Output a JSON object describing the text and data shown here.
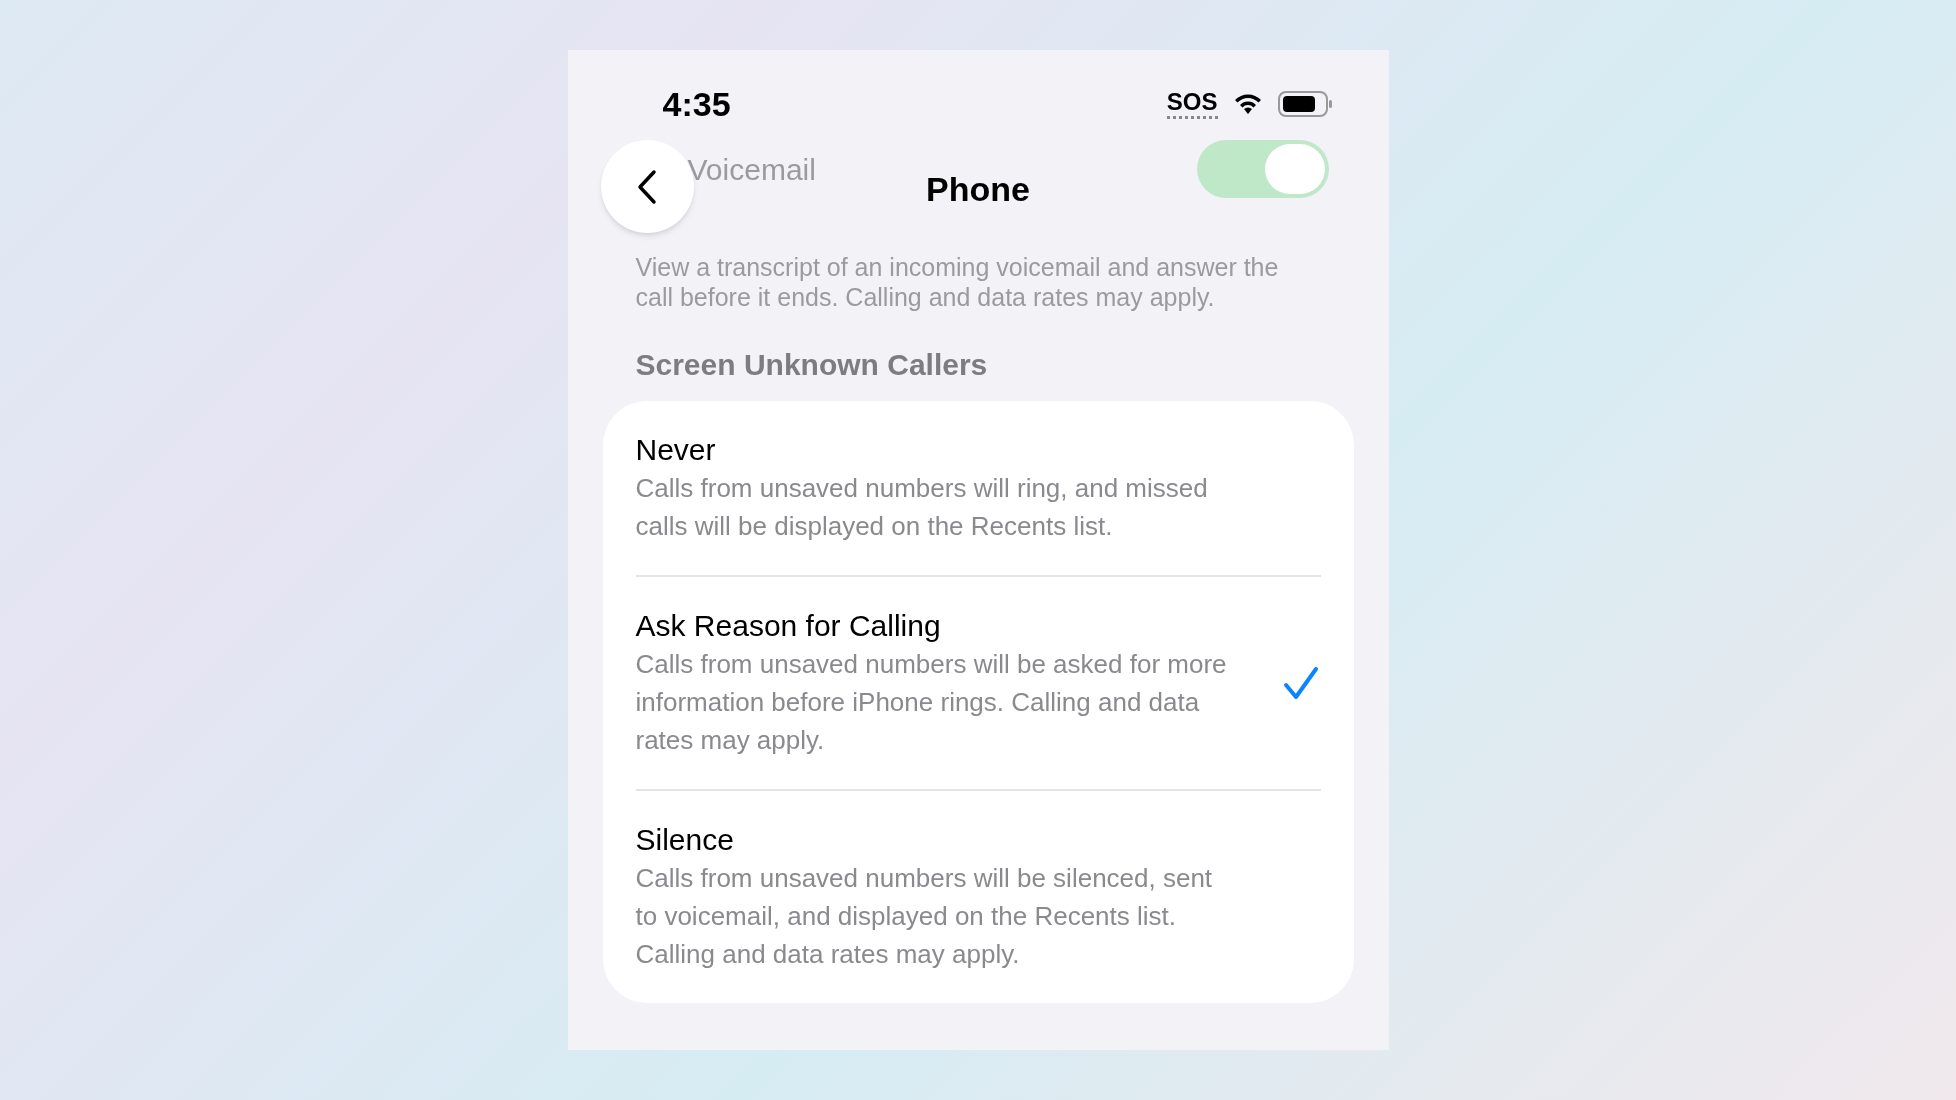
{
  "status_bar": {
    "time": "4:35",
    "sos": "SOS"
  },
  "background_row": {
    "label": "Voicemail",
    "on": true
  },
  "nav": {
    "title": "Phone"
  },
  "description": "View a transcript of an incoming voicemail and answer the call before it ends. Calling and data rates may apply.",
  "section": {
    "title": "Screen Unknown Callers",
    "options": [
      {
        "title": "Never",
        "description": "Calls from unsaved numbers will ring, and missed calls will be displayed on the Recents list.",
        "selected": false
      },
      {
        "title": "Ask Reason for Calling",
        "description": "Calls from unsaved numbers will be asked for more information before iPhone rings. Calling and data rates may apply.",
        "selected": true
      },
      {
        "title": "Silence",
        "description": "Calls from unsaved numbers will be silenced, sent to voicemail, and displayed on the Recents list. Calling and data rates may apply.",
        "selected": false
      }
    ]
  }
}
